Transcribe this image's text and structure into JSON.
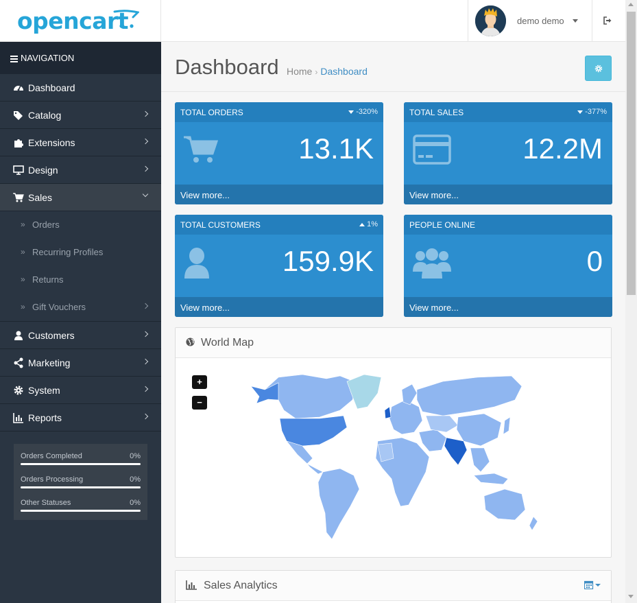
{
  "header": {
    "logo_text": "opencart",
    "user_name": "demo demo"
  },
  "sidebar": {
    "nav_title": "NAVIGATION",
    "items": [
      {
        "label": "Dashboard",
        "icon": "dashboard-icon"
      },
      {
        "label": "Catalog",
        "icon": "tags-icon"
      },
      {
        "label": "Extensions",
        "icon": "puzzle-icon"
      },
      {
        "label": "Design",
        "icon": "monitor-icon"
      },
      {
        "label": "Sales",
        "icon": "shopping-cart-icon"
      },
      {
        "label": "Customers",
        "icon": "user-icon"
      },
      {
        "label": "Marketing",
        "icon": "share-icon"
      },
      {
        "label": "System",
        "icon": "gear-icon"
      },
      {
        "label": "Reports",
        "icon": "bar-chart-icon"
      }
    ],
    "sales_subitems": [
      "Orders",
      "Recurring Profiles",
      "Returns",
      "Gift Vouchers"
    ],
    "stats": [
      {
        "label": "Orders Completed",
        "value": "0%"
      },
      {
        "label": "Orders Processing",
        "value": "0%"
      },
      {
        "label": "Other Statuses",
        "value": "0%"
      }
    ]
  },
  "page": {
    "title": "Dashboard",
    "breadcrumb": [
      "Home",
      "Dashboard"
    ]
  },
  "tiles": [
    {
      "title": "TOTAL ORDERS",
      "change": "-320%",
      "trend": "down",
      "value": "13.1K",
      "footer": "View more...",
      "icon": "shopping-cart-icon"
    },
    {
      "title": "TOTAL SALES",
      "change": "-377%",
      "trend": "down",
      "value": "12.2M",
      "footer": "View more...",
      "icon": "credit-card-icon"
    },
    {
      "title": "TOTAL CUSTOMERS",
      "change": "1%",
      "trend": "up",
      "value": "159.9K",
      "footer": "View more...",
      "icon": "user-icon"
    },
    {
      "title": "PEOPLE ONLINE",
      "change": "",
      "trend": "",
      "value": "0",
      "footer": "View more...",
      "icon": "users-icon"
    }
  ],
  "world_map": {
    "title": "World Map",
    "zoom_in": "+",
    "zoom_out": "−"
  },
  "sales_analytics": {
    "title": "Sales Analytics"
  },
  "colors": {
    "sidebar_bg": "#2a3542",
    "tile_bg": "#2c8ecf",
    "brand": "#26a5d8",
    "map_base": "#8fb6f0",
    "map_highlight": "#1d5fc9"
  }
}
